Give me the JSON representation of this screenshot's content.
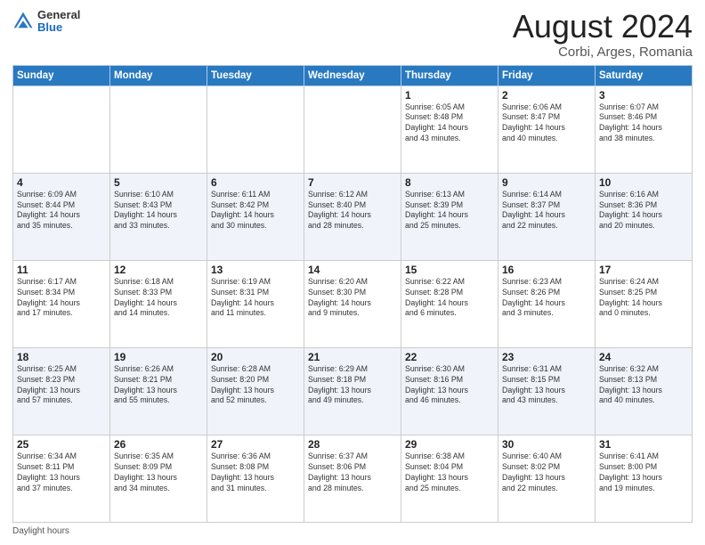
{
  "header": {
    "logo_general": "General",
    "logo_blue": "Blue",
    "title": "August 2024",
    "location": "Corbi, Arges, Romania"
  },
  "days_of_week": [
    "Sunday",
    "Monday",
    "Tuesday",
    "Wednesday",
    "Thursday",
    "Friday",
    "Saturday"
  ],
  "weeks": [
    [
      {
        "day": "",
        "info": ""
      },
      {
        "day": "",
        "info": ""
      },
      {
        "day": "",
        "info": ""
      },
      {
        "day": "",
        "info": ""
      },
      {
        "day": "1",
        "info": "Sunrise: 6:05 AM\nSunset: 8:48 PM\nDaylight: 14 hours\nand 43 minutes."
      },
      {
        "day": "2",
        "info": "Sunrise: 6:06 AM\nSunset: 8:47 PM\nDaylight: 14 hours\nand 40 minutes."
      },
      {
        "day": "3",
        "info": "Sunrise: 6:07 AM\nSunset: 8:46 PM\nDaylight: 14 hours\nand 38 minutes."
      }
    ],
    [
      {
        "day": "4",
        "info": "Sunrise: 6:09 AM\nSunset: 8:44 PM\nDaylight: 14 hours\nand 35 minutes."
      },
      {
        "day": "5",
        "info": "Sunrise: 6:10 AM\nSunset: 8:43 PM\nDaylight: 14 hours\nand 33 minutes."
      },
      {
        "day": "6",
        "info": "Sunrise: 6:11 AM\nSunset: 8:42 PM\nDaylight: 14 hours\nand 30 minutes."
      },
      {
        "day": "7",
        "info": "Sunrise: 6:12 AM\nSunset: 8:40 PM\nDaylight: 14 hours\nand 28 minutes."
      },
      {
        "day": "8",
        "info": "Sunrise: 6:13 AM\nSunset: 8:39 PM\nDaylight: 14 hours\nand 25 minutes."
      },
      {
        "day": "9",
        "info": "Sunrise: 6:14 AM\nSunset: 8:37 PM\nDaylight: 14 hours\nand 22 minutes."
      },
      {
        "day": "10",
        "info": "Sunrise: 6:16 AM\nSunset: 8:36 PM\nDaylight: 14 hours\nand 20 minutes."
      }
    ],
    [
      {
        "day": "11",
        "info": "Sunrise: 6:17 AM\nSunset: 8:34 PM\nDaylight: 14 hours\nand 17 minutes."
      },
      {
        "day": "12",
        "info": "Sunrise: 6:18 AM\nSunset: 8:33 PM\nDaylight: 14 hours\nand 14 minutes."
      },
      {
        "day": "13",
        "info": "Sunrise: 6:19 AM\nSunset: 8:31 PM\nDaylight: 14 hours\nand 11 minutes."
      },
      {
        "day": "14",
        "info": "Sunrise: 6:20 AM\nSunset: 8:30 PM\nDaylight: 14 hours\nand 9 minutes."
      },
      {
        "day": "15",
        "info": "Sunrise: 6:22 AM\nSunset: 8:28 PM\nDaylight: 14 hours\nand 6 minutes."
      },
      {
        "day": "16",
        "info": "Sunrise: 6:23 AM\nSunset: 8:26 PM\nDaylight: 14 hours\nand 3 minutes."
      },
      {
        "day": "17",
        "info": "Sunrise: 6:24 AM\nSunset: 8:25 PM\nDaylight: 14 hours\nand 0 minutes."
      }
    ],
    [
      {
        "day": "18",
        "info": "Sunrise: 6:25 AM\nSunset: 8:23 PM\nDaylight: 13 hours\nand 57 minutes."
      },
      {
        "day": "19",
        "info": "Sunrise: 6:26 AM\nSunset: 8:21 PM\nDaylight: 13 hours\nand 55 minutes."
      },
      {
        "day": "20",
        "info": "Sunrise: 6:28 AM\nSunset: 8:20 PM\nDaylight: 13 hours\nand 52 minutes."
      },
      {
        "day": "21",
        "info": "Sunrise: 6:29 AM\nSunset: 8:18 PM\nDaylight: 13 hours\nand 49 minutes."
      },
      {
        "day": "22",
        "info": "Sunrise: 6:30 AM\nSunset: 8:16 PM\nDaylight: 13 hours\nand 46 minutes."
      },
      {
        "day": "23",
        "info": "Sunrise: 6:31 AM\nSunset: 8:15 PM\nDaylight: 13 hours\nand 43 minutes."
      },
      {
        "day": "24",
        "info": "Sunrise: 6:32 AM\nSunset: 8:13 PM\nDaylight: 13 hours\nand 40 minutes."
      }
    ],
    [
      {
        "day": "25",
        "info": "Sunrise: 6:34 AM\nSunset: 8:11 PM\nDaylight: 13 hours\nand 37 minutes."
      },
      {
        "day": "26",
        "info": "Sunrise: 6:35 AM\nSunset: 8:09 PM\nDaylight: 13 hours\nand 34 minutes."
      },
      {
        "day": "27",
        "info": "Sunrise: 6:36 AM\nSunset: 8:08 PM\nDaylight: 13 hours\nand 31 minutes."
      },
      {
        "day": "28",
        "info": "Sunrise: 6:37 AM\nSunset: 8:06 PM\nDaylight: 13 hours\nand 28 minutes."
      },
      {
        "day": "29",
        "info": "Sunrise: 6:38 AM\nSunset: 8:04 PM\nDaylight: 13 hours\nand 25 minutes."
      },
      {
        "day": "30",
        "info": "Sunrise: 6:40 AM\nSunset: 8:02 PM\nDaylight: 13 hours\nand 22 minutes."
      },
      {
        "day": "31",
        "info": "Sunrise: 6:41 AM\nSunset: 8:00 PM\nDaylight: 13 hours\nand 19 minutes."
      }
    ]
  ],
  "footer": {
    "daylight_label": "Daylight hours"
  }
}
